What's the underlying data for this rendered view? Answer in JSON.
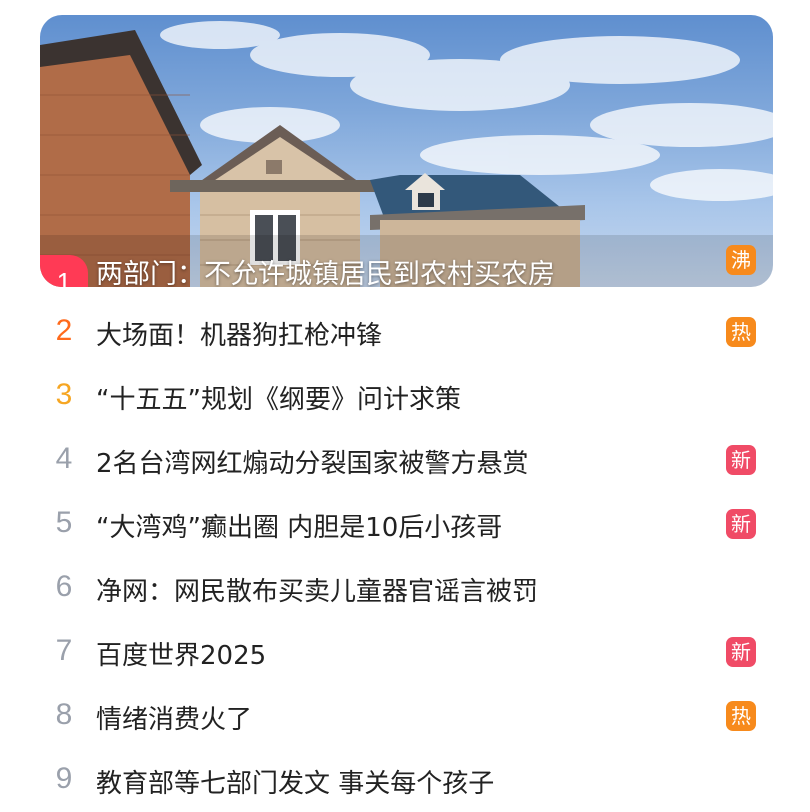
{
  "colors": {
    "rank1": "#ff3a55",
    "rank2": "#ff6a1c",
    "rank3": "#f6a623",
    "rank_default": "#9aa0ab",
    "badge_boil": "#f78a1c",
    "badge_hot": "#f78a1c",
    "badge_new": "#f04b66"
  },
  "featured": {
    "rank": "1",
    "title": "两部门：不允许城镇居民到农村买农房",
    "badge": "沸",
    "image": "house-sky-photo"
  },
  "items": [
    {
      "rank": "2",
      "title": "大场面！机器狗扛枪冲锋",
      "badge": "热",
      "badge_type": "hot"
    },
    {
      "rank": "3",
      "title": "“十五五”规划《纲要》问计求策",
      "badge": "",
      "badge_type": ""
    },
    {
      "rank": "4",
      "title": "2名台湾网红煽动分裂国家被警方悬赏",
      "badge": "新",
      "badge_type": "new"
    },
    {
      "rank": "5",
      "title": "“大湾鸡”癫出圈 内胆是10后小孩哥",
      "badge": "新",
      "badge_type": "new"
    },
    {
      "rank": "6",
      "title": "净网：网民散布买卖儿童器官谣言被罚",
      "badge": "",
      "badge_type": ""
    },
    {
      "rank": "7",
      "title": "百度世界2025",
      "badge": "新",
      "badge_type": "new"
    },
    {
      "rank": "8",
      "title": "情绪消费火了",
      "badge": "热",
      "badge_type": "hot"
    },
    {
      "rank": "9",
      "title": "教育部等七部门发文 事关每个孩子",
      "badge": "",
      "badge_type": ""
    }
  ]
}
